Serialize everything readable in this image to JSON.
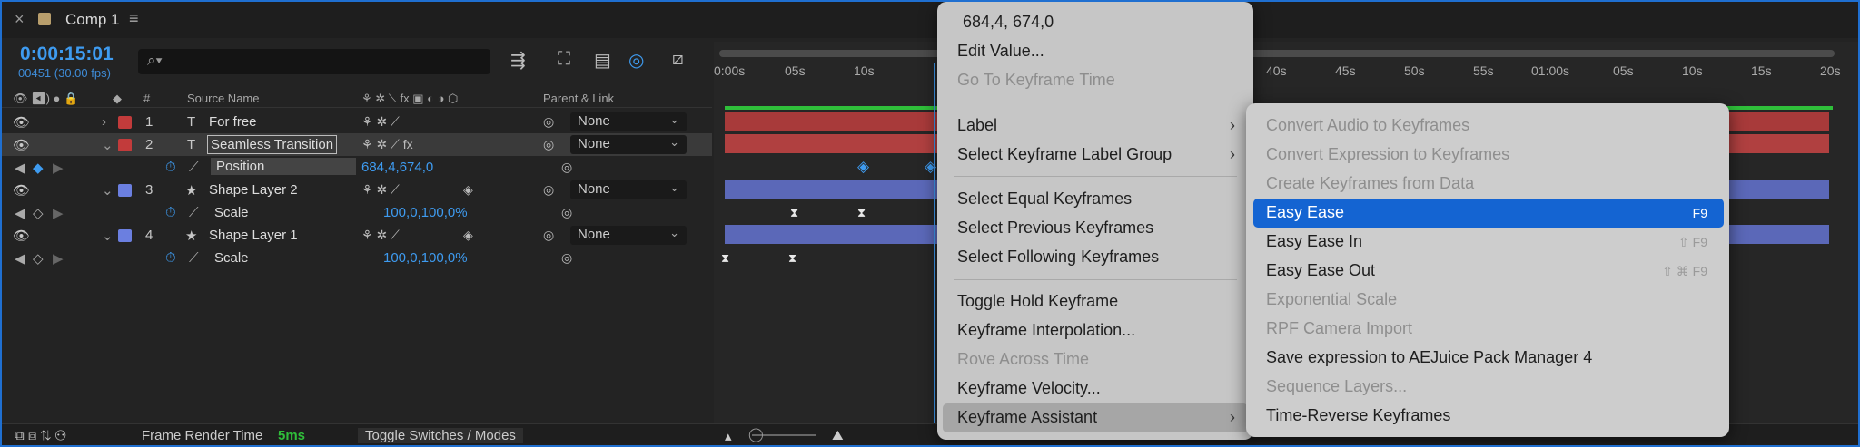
{
  "tab": {
    "close": "×",
    "title": "Comp 1",
    "menu_icon": "≡"
  },
  "timecode": "0:00:15:01",
  "frame_info": "00451 (30.00 fps)",
  "search": {
    "placeholder": ""
  },
  "columns": {
    "source_name": "Source Name",
    "parent_link": "Parent & Link",
    "hash": "#"
  },
  "layers": [
    {
      "index": "1",
      "type_icon": "T",
      "name": "For free",
      "parent": "None",
      "label_color": "#c23b3b"
    },
    {
      "index": "2",
      "type_icon": "T",
      "name": "Seamless Transition",
      "parent": "None",
      "label_color": "#c23b3b"
    },
    {
      "property": "Position",
      "value": "684,4,674,0"
    },
    {
      "index": "3",
      "type_icon": "★",
      "name": "Shape Layer 2",
      "parent": "None",
      "label_color": "#6b7fe0"
    },
    {
      "property": "Scale",
      "value": "100,0,100,0%"
    },
    {
      "index": "4",
      "type_icon": "★",
      "name": "Shape Layer 1",
      "parent": "None",
      "label_color": "#6b7fe0"
    },
    {
      "property": "Scale",
      "value": "100,0,100,0%"
    }
  ],
  "ruler_ticks": [
    "0:00s",
    "05s",
    "10s",
    "40s",
    "45s",
    "50s",
    "55s",
    "01:00s",
    "05s",
    "10s",
    "15s",
    "20s"
  ],
  "bottom": {
    "frame_render_label": "Frame Render Time",
    "frame_render_value": "5ms",
    "toggle": "Toggle Switches / Modes"
  },
  "menu1": {
    "value_header": "684,4, 674,0",
    "items": [
      {
        "label": "Edit Value...",
        "disabled": false
      },
      {
        "label": "Go To Keyframe Time",
        "disabled": true
      },
      {
        "label": "Label",
        "disabled": false
      },
      {
        "label": "Select Keyframe Label Group",
        "disabled": false
      },
      {
        "label": "Select Equal Keyframes",
        "disabled": false
      },
      {
        "label": "Select Previous Keyframes",
        "disabled": false
      },
      {
        "label": "Select Following Keyframes",
        "disabled": false
      },
      {
        "label": "Toggle Hold Keyframe",
        "disabled": false
      },
      {
        "label": "Keyframe Interpolation...",
        "disabled": false
      },
      {
        "label": "Rove Across Time",
        "disabled": true
      },
      {
        "label": "Keyframe Velocity...",
        "disabled": false
      },
      {
        "label": "Keyframe Assistant",
        "disabled": false
      }
    ]
  },
  "menu2": {
    "items": [
      {
        "label": "Convert Audio to Keyframes",
        "disabled": true,
        "shortcut": ""
      },
      {
        "label": "Convert Expression to Keyframes",
        "disabled": true,
        "shortcut": ""
      },
      {
        "label": "Create Keyframes from Data",
        "disabled": true,
        "shortcut": ""
      },
      {
        "label": "Easy Ease",
        "disabled": false,
        "shortcut": "F9"
      },
      {
        "label": "Easy Ease In",
        "disabled": false,
        "shortcut": "⇧ F9"
      },
      {
        "label": "Easy Ease Out",
        "disabled": false,
        "shortcut": "⇧ ⌘ F9"
      },
      {
        "label": "Exponential Scale",
        "disabled": true,
        "shortcut": ""
      },
      {
        "label": "RPF Camera Import",
        "disabled": true,
        "shortcut": ""
      },
      {
        "label": "Save expression to AEJuice Pack Manager 4",
        "disabled": false,
        "shortcut": ""
      },
      {
        "label": "Sequence Layers...",
        "disabled": true,
        "shortcut": ""
      },
      {
        "label": "Time-Reverse Keyframes",
        "disabled": false,
        "shortcut": ""
      }
    ]
  },
  "colors": {
    "accent": "#3e9bf0",
    "highlight": "#1464d2",
    "red_bar": "#a83a3a",
    "blue_bar": "#5b68b8",
    "green": "#2fbf3a"
  }
}
